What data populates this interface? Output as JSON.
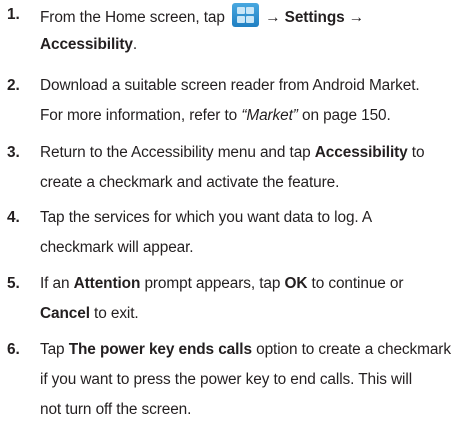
{
  "steps": [
    {
      "num": "1.",
      "l1_a": "From the Home screen, tap ",
      "l1_arrow1": " → ",
      "l1_settings": "Settings",
      "l1_arrow2": " →",
      "l2_accessibility": "Accessibility",
      "l2_end": ".",
      "icon": "applications-grid-icon"
    },
    {
      "num": "2.",
      "l1": "Download a suitable screen reader from Android Market.",
      "l2_a": "For more information, refer to ",
      "l2_ref": "“Market”",
      "l2_b": " on page 150."
    },
    {
      "num": "3.",
      "l1_a": "Return to the Accessibility menu and tap ",
      "l1_bold": "Accessibility",
      "l1_b": " to",
      "l2": "create a checkmark and activate the feature."
    },
    {
      "num": "4.",
      "l1": "Tap the services for which you want data to log. A",
      "l2": "checkmark will appear."
    },
    {
      "num": "5.",
      "l1_a": "If an ",
      "l1_bold1": "Attention",
      "l1_b": " prompt appears, tap ",
      "l1_bold2": "OK",
      "l1_c": " to continue or",
      "l2_bold": "Cancel",
      "l2_b": " to exit."
    },
    {
      "num": "6.",
      "l1_a": "Tap ",
      "l1_bold": "The power key ends calls",
      "l1_b": " option to create a checkmark",
      "l2": "if you want to press the power key to end calls. This will",
      "l3": "not turn off the screen."
    }
  ]
}
